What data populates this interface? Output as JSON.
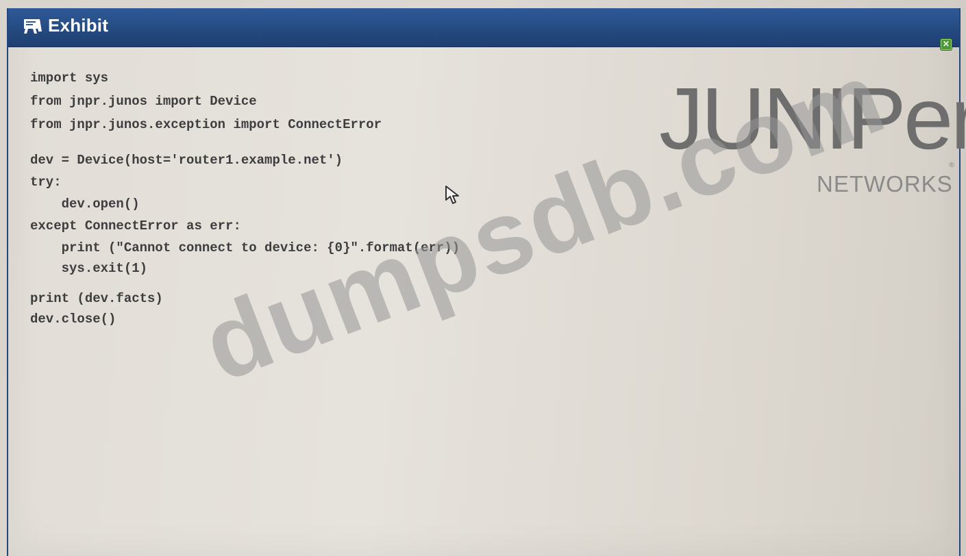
{
  "window": {
    "title": "Exhibit",
    "title_icon": "exhibit-icon",
    "close_icon": "close-icon",
    "close_glyph": "×"
  },
  "code_lines": [
    "import sys",
    "from jnpr.junos import Device",
    "from jnpr.junos.exception import ConnectError",
    "",
    "dev = Device(host='router1.example.net')",
    "try:",
    "    dev.open()",
    "except ConnectError as err:",
    "    print (\"Cannot connect to device: {0}\".format(err))",
    "    sys.exit(1)",
    "",
    "print (dev.facts)",
    "dev.close()"
  ],
  "logo": {
    "brand": "JUNIPer",
    "subtitle": "NETWORKS",
    "registered_mark": "®"
  },
  "watermark": {
    "text": "dumpsdb.com"
  },
  "colors": {
    "titlebar": "#24497f",
    "close_button": "#4d9a35",
    "code_text": "#3d3d3f",
    "logo": "#6e6e6e"
  }
}
